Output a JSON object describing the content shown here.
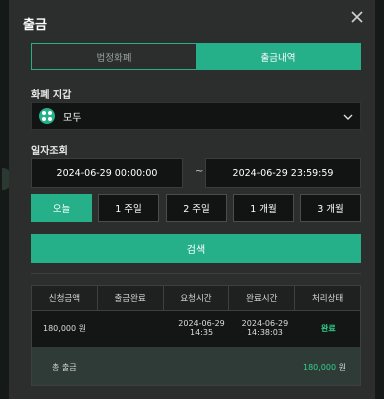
{
  "modal": {
    "title": "출금"
  },
  "tabs": [
    {
      "label": "법정화폐"
    },
    {
      "label": "출금내역"
    }
  ],
  "currency": {
    "label": "화폐 지갑",
    "selected": "모두"
  },
  "dates": {
    "label": "일자조회",
    "start": "2024-06-29 00:00:00",
    "separator": "~",
    "end": "2024-06-29 23:59:59"
  },
  "periods": [
    {
      "label": "오늘"
    },
    {
      "label": "1 주일"
    },
    {
      "label": "2 주일"
    },
    {
      "label": "1 개월"
    },
    {
      "label": "3 개월"
    }
  ],
  "search": {
    "label": "검색"
  },
  "table": {
    "headers": [
      "신청금액",
      "출금완료",
      "요청시간",
      "완료시간",
      "처리상태"
    ],
    "rows": [
      {
        "amount": "180,000 원",
        "completed": "",
        "request_date": "2024-06-29",
        "request_time": "14:35",
        "done_date": "2024-06-29",
        "done_time": "14:38:03",
        "status": "완료"
      }
    ],
    "total_label": "총 출금",
    "total_value": "180,000",
    "total_unit": "원"
  },
  "colors": {
    "accent": "#26b08a",
    "status_done": "#33d08f",
    "modal_bg": "#2b2e2d"
  }
}
